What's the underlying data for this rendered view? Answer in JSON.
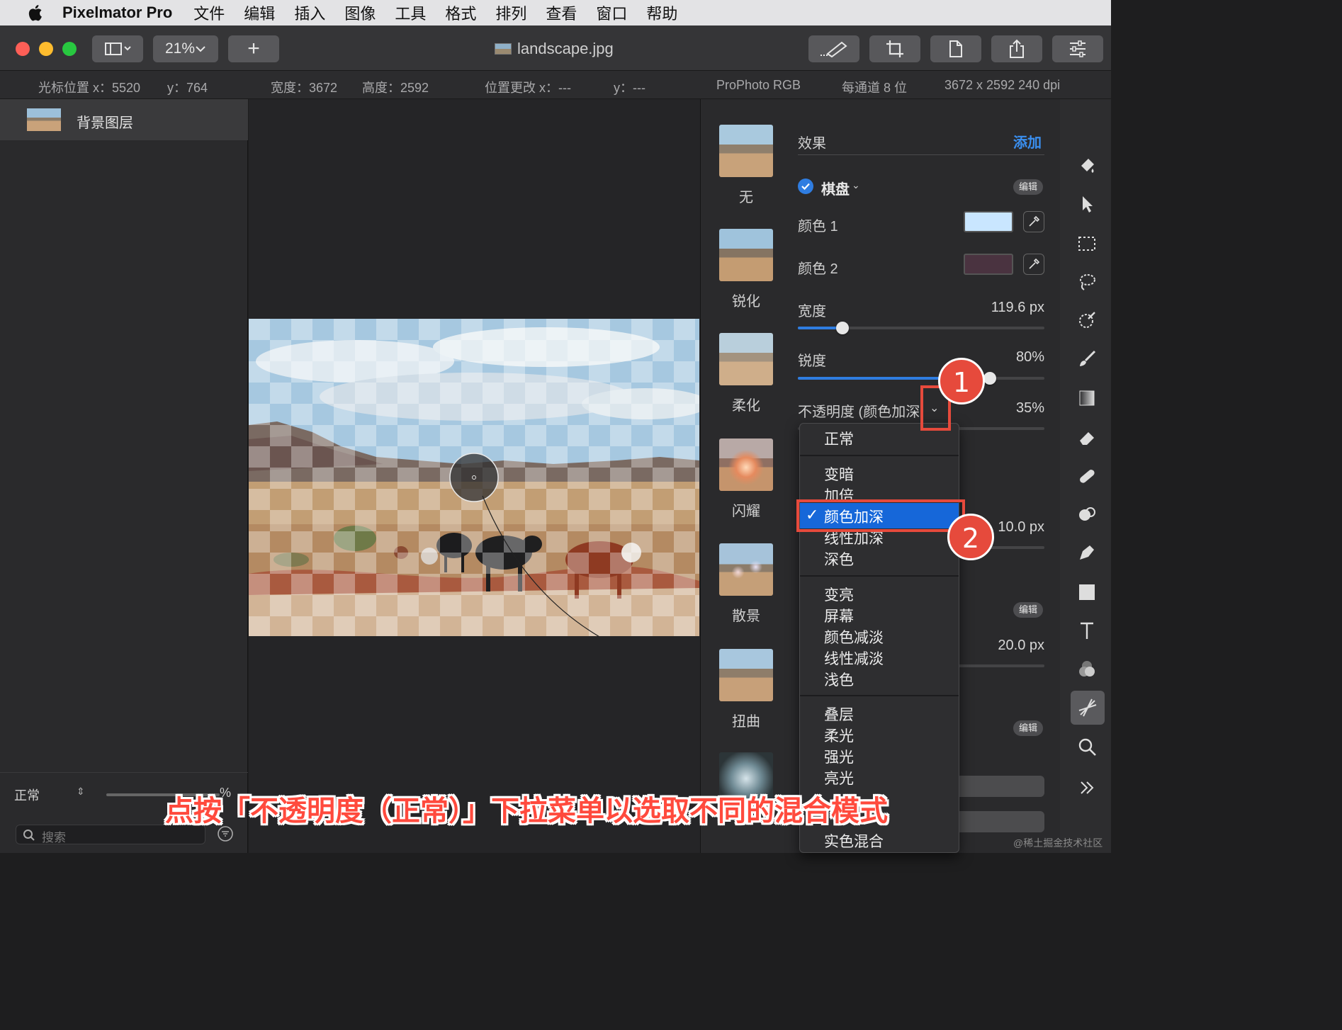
{
  "menubar": {
    "app_name": "Pixelmator Pro",
    "items": [
      "文件",
      "编辑",
      "插入",
      "图像",
      "工具",
      "格式",
      "排列",
      "查看",
      "窗口",
      "帮助"
    ]
  },
  "toolbar": {
    "zoom": "21%",
    "add_label": "+",
    "document_title": "landscape.jpg"
  },
  "infobar": {
    "cursor_x": "光标位置 x：5520",
    "cursor_y": "y：764",
    "width": "宽度：3672",
    "height": "高度：2592",
    "move_x": "位置更改 x：---",
    "move_y": "y：---",
    "color_profile": "ProPhoto RGB",
    "bit_depth": "每通道 8 位",
    "dimensions": "3672 x 2592 240 dpi"
  },
  "layers": {
    "items": [
      {
        "name": "背景图层"
      }
    ],
    "blend_mode": "正常",
    "opacity_suffix": "%",
    "search_placeholder": "搜索"
  },
  "effects_browser": {
    "items": [
      "无",
      "锐化",
      "柔化",
      "闪耀",
      "散景",
      "扭曲"
    ]
  },
  "properties": {
    "effects_header": "效果",
    "add_label": "添加",
    "effect_name": "棋盘",
    "edit_label": "编辑",
    "color1_label": "颜色 1",
    "color1_value": "#c9e6ff",
    "color2_label": "颜色 2",
    "color2_value": "#4a3340",
    "width_label": "宽度",
    "width_value": "119.6 px",
    "width_fraction": 0.18,
    "sharpness_label": "锐度",
    "sharpness_value": "80%",
    "opacity_label": "不透明度 (颜色加深",
    "opacity_value": "35%",
    "hidden_value_1": "10.0 px",
    "hidden_value_2": "20.0 px",
    "edit_label_2": "编辑",
    "edit_label_3": "编辑"
  },
  "dropdown": {
    "groups": [
      [
        "正常"
      ],
      [
        "变暗",
        "加倍",
        "颜色加深",
        "线性加深",
        "深色"
      ],
      [
        "变亮",
        "屏幕",
        "颜色减淡",
        "线性减淡",
        "浅色"
      ],
      [
        "叠层",
        "柔光",
        "强光",
        "亮光"
      ]
    ],
    "selected": "颜色加深",
    "check": "✓",
    "last_visible": "实色混合"
  },
  "annotations": {
    "badge1": "1",
    "badge2": "2",
    "caption": "点按「不透明度（正常）」下拉菜单以选取不同的混合模式",
    "watermark": "@稀土掘金技术社区",
    "accent": "#e64a3c"
  },
  "colors": {
    "accent_blue": "#2f7de1",
    "selection_blue": "#1667d9"
  }
}
